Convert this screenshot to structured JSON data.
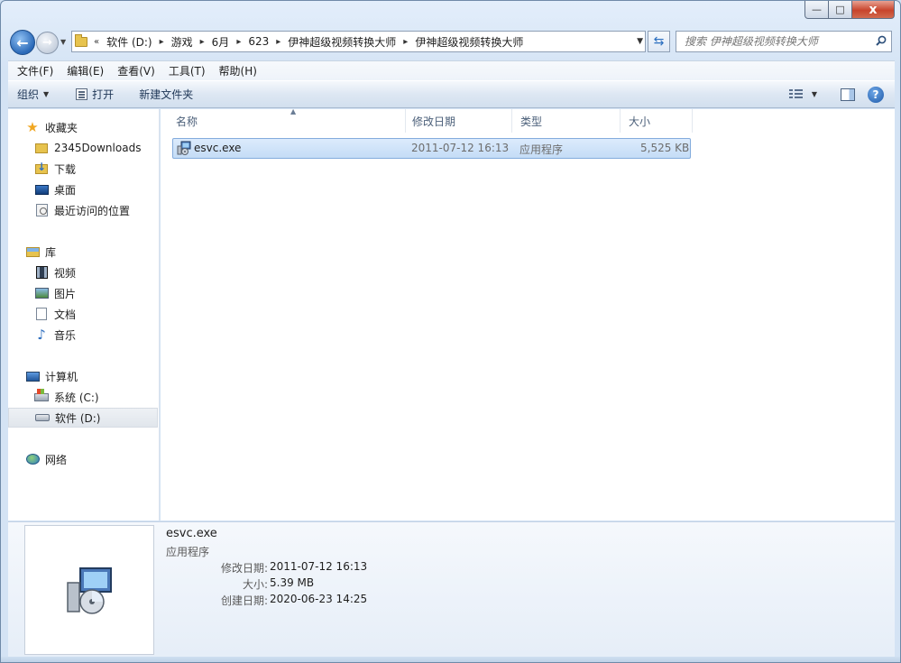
{
  "window": {
    "caption_buttons": {
      "minimize": "—",
      "maximize": "□",
      "close": "x"
    }
  },
  "address": {
    "overflow": "«",
    "crumbs": [
      "软件 (D:)",
      "游戏",
      "6月",
      "623",
      "伊神超级视频转换大师",
      "伊神超级视频转换大师"
    ],
    "search_placeholder": "搜索 伊神超级视频转换大师"
  },
  "menubar": [
    "文件(F)",
    "编辑(E)",
    "查看(V)",
    "工具(T)",
    "帮助(H)"
  ],
  "toolbar": {
    "organize": "组织",
    "open": "打开",
    "new_folder": "新建文件夹"
  },
  "nav": {
    "favorites": {
      "label": "收藏夹",
      "items": [
        "2345Downloads",
        "下载",
        "桌面",
        "最近访问的位置"
      ]
    },
    "libraries": {
      "label": "库",
      "items": [
        "视频",
        "图片",
        "文档",
        "音乐"
      ]
    },
    "computer": {
      "label": "计算机",
      "items": [
        "系统 (C:)",
        "软件 (D:)"
      ],
      "selected": "软件 (D:)"
    },
    "network": {
      "label": "网络"
    }
  },
  "columns": [
    "名称",
    "修改日期",
    "类型",
    "大小"
  ],
  "files": [
    {
      "name": "esvc.exe",
      "modified": "2011-07-12 16:13",
      "type": "应用程序",
      "size": "5,525 KB",
      "icon": "installer-exe-icon"
    }
  ],
  "details": {
    "name": "esvc.exe",
    "type": "应用程序",
    "fields": [
      {
        "label": "修改日期:",
        "value": "2011-07-12 16:13"
      },
      {
        "label": "大小:",
        "value": "5.39 MB"
      },
      {
        "label": "创建日期:",
        "value": "2020-06-23 14:25"
      }
    ]
  },
  "colors": {
    "selection_bg": "#c4dcf6",
    "selection_border": "#84acdd",
    "close_red": "#c8442c",
    "chrome": "#d4e3f4"
  }
}
